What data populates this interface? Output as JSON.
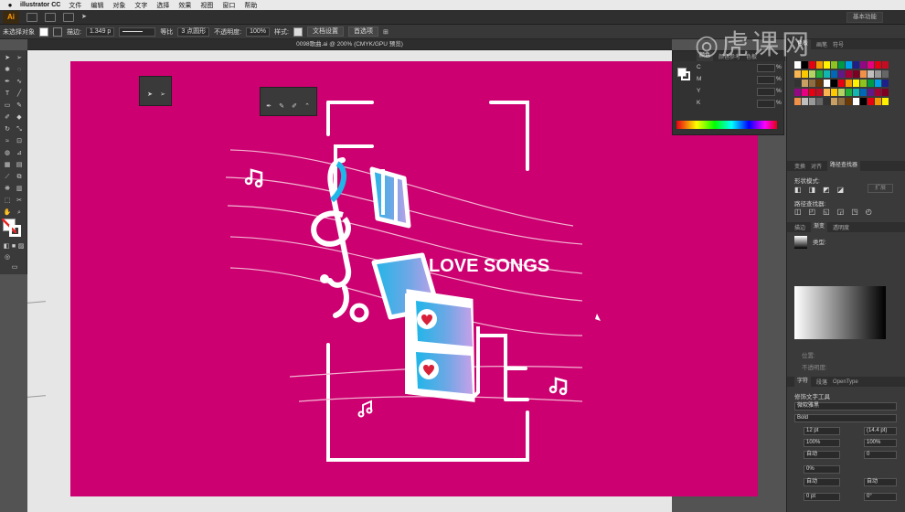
{
  "menubar": {
    "app_name": "illustrator CC",
    "items": [
      "文件",
      "编辑",
      "对象",
      "文字",
      "选择",
      "效果",
      "视图",
      "窗口",
      "帮助"
    ]
  },
  "appbar": {
    "logo": "Ai",
    "workspace_label": "基本功能"
  },
  "control": {
    "selection": "未选择对象",
    "stroke_label": "描边:",
    "stroke_value": "1.349 p",
    "line_style": "等比",
    "brush": "3 点圆形",
    "opacity_label": "不透明度:",
    "opacity_value": "100%",
    "style_label": "样式:",
    "doc_setup": "文档设置",
    "prefs": "首选项"
  },
  "document": {
    "tab_title": "0098歌曲.ai @ 200% (CMYK/GPU 预览)",
    "close_glyph": "×"
  },
  "artwork": {
    "title": "LOVE SONGS"
  },
  "colors": {
    "artboard": "#cc0070",
    "accent_blue": "#1fb6e8",
    "heart_red": "#d8203a"
  },
  "color_panel": {
    "tabs": [
      "颜色",
      "颜色参考",
      "色板"
    ],
    "channels": [
      "C",
      "M",
      "Y",
      "K"
    ],
    "units": [
      "%",
      "%",
      "%",
      "%"
    ]
  },
  "right_panels": {
    "swatch_tabs": [
      "色板",
      "画笔",
      "符号"
    ],
    "transform_tabs": [
      "变换",
      "对齐",
      "路径查找器"
    ],
    "shape_modes_label": "形状模式:",
    "pathfinder_label": "路径查找器:",
    "expand_label": "扩展",
    "gradient_tabs": [
      "描边",
      "渐变",
      "透明度"
    ],
    "gradient_type_label": "类型:",
    "gradient_location": "位置:",
    "gradient_opacity": "不透明度:",
    "char_tabs": [
      "字符",
      "段落",
      "OpenType"
    ],
    "touch_type": "修饰文字工具",
    "font_search": "微软雅黑",
    "font_style": "Bold",
    "font_size": "12 pt",
    "leading": "(14.4 pt)",
    "scale_h": "100%",
    "scale_v": "100%",
    "kerning": "自动",
    "tracking": "0",
    "baseline": "0%",
    "char_rotate": "0°",
    "auto1": "自动",
    "auto2": "自动",
    "pt_shift": "0 pt",
    "zero": "0°"
  }
}
